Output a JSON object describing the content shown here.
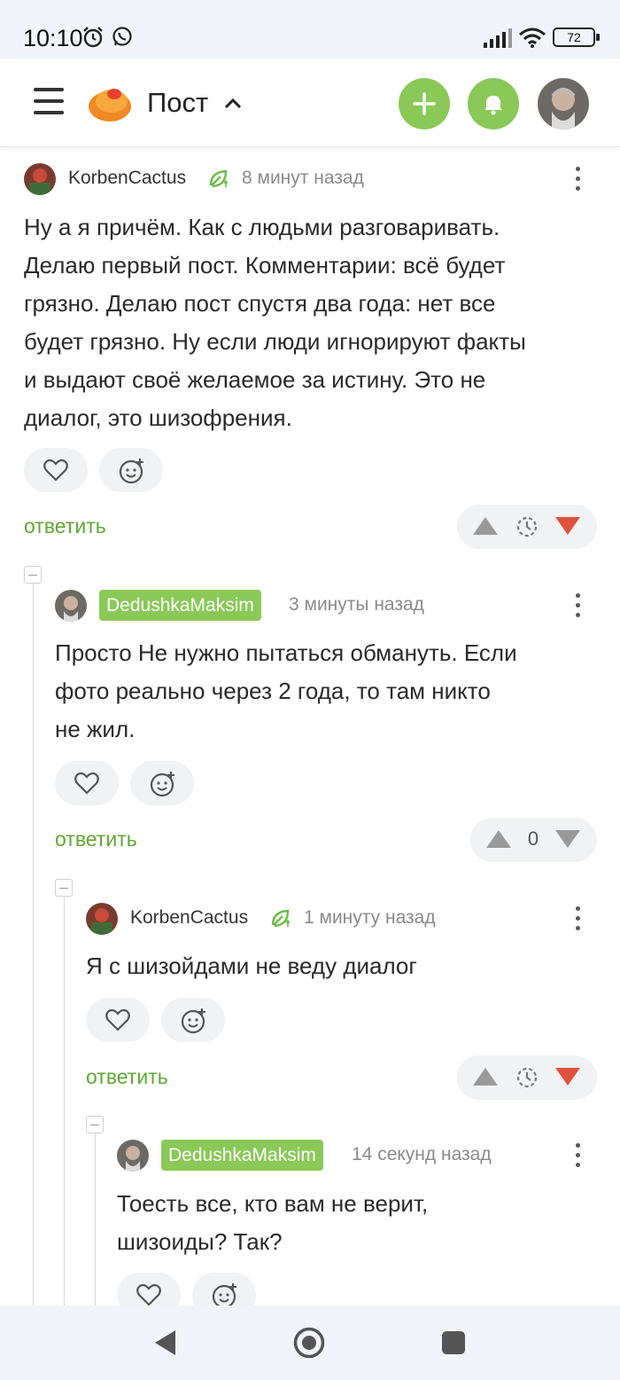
{
  "status": {
    "time": "10:10",
    "battery": "72",
    "icons": [
      "alarm-icon",
      "whatsapp-icon",
      "signal-icon",
      "wifi-icon",
      "battery-icon"
    ]
  },
  "header": {
    "title": "Пост",
    "icons": [
      "menu-icon",
      "pikabu-logo",
      "chevron-up-icon",
      "plus-icon",
      "bell-icon",
      "profile-avatar"
    ],
    "accent": "#8ac858"
  },
  "comments": [
    {
      "author": "KorbenCactus",
      "time": "8 минут назад",
      "lines": [
        "Ну а я причём. Как с людьми разговаривать.",
        "Делаю первый пост. Комментарии: всё будет",
        "грязно. Делаю пост спустя два года: нет все",
        "будет грязно. Ну если люди игнорируют факты",
        "и выдают своё желаемое за истину. Это не",
        "диалог, это шизофрения."
      ],
      "reply": "ответить",
      "vote_state": "downvoted"
    },
    {
      "author": "DedushkaMaksim",
      "time": "3 минуты назад",
      "lines": [
        "Просто Не нужно пытаться обмануть. Если",
        "фото реально через 2 года, то там никто",
        "не жил."
      ],
      "reply": "ответить",
      "rating": "0"
    },
    {
      "author": "KorbenCactus",
      "time": "1 минуту назад",
      "lines": [
        "Я с шизойдами не веду диалог"
      ],
      "reply": "ответить",
      "vote_state": "downvoted"
    },
    {
      "author": "DedushkaMaksim",
      "time": "14 секунд назад",
      "lines": [
        "Тоесть все, кто вам не верит,",
        "шизоиды? Так?"
      ]
    }
  ],
  "colors": {
    "green": "#8ac858",
    "reply_green": "#5fa732",
    "downvote_red": "#e0513e",
    "muted": "#8a8a8a"
  },
  "nav": {
    "icons": [
      "back-icon",
      "home-icon",
      "recents-icon"
    ]
  }
}
